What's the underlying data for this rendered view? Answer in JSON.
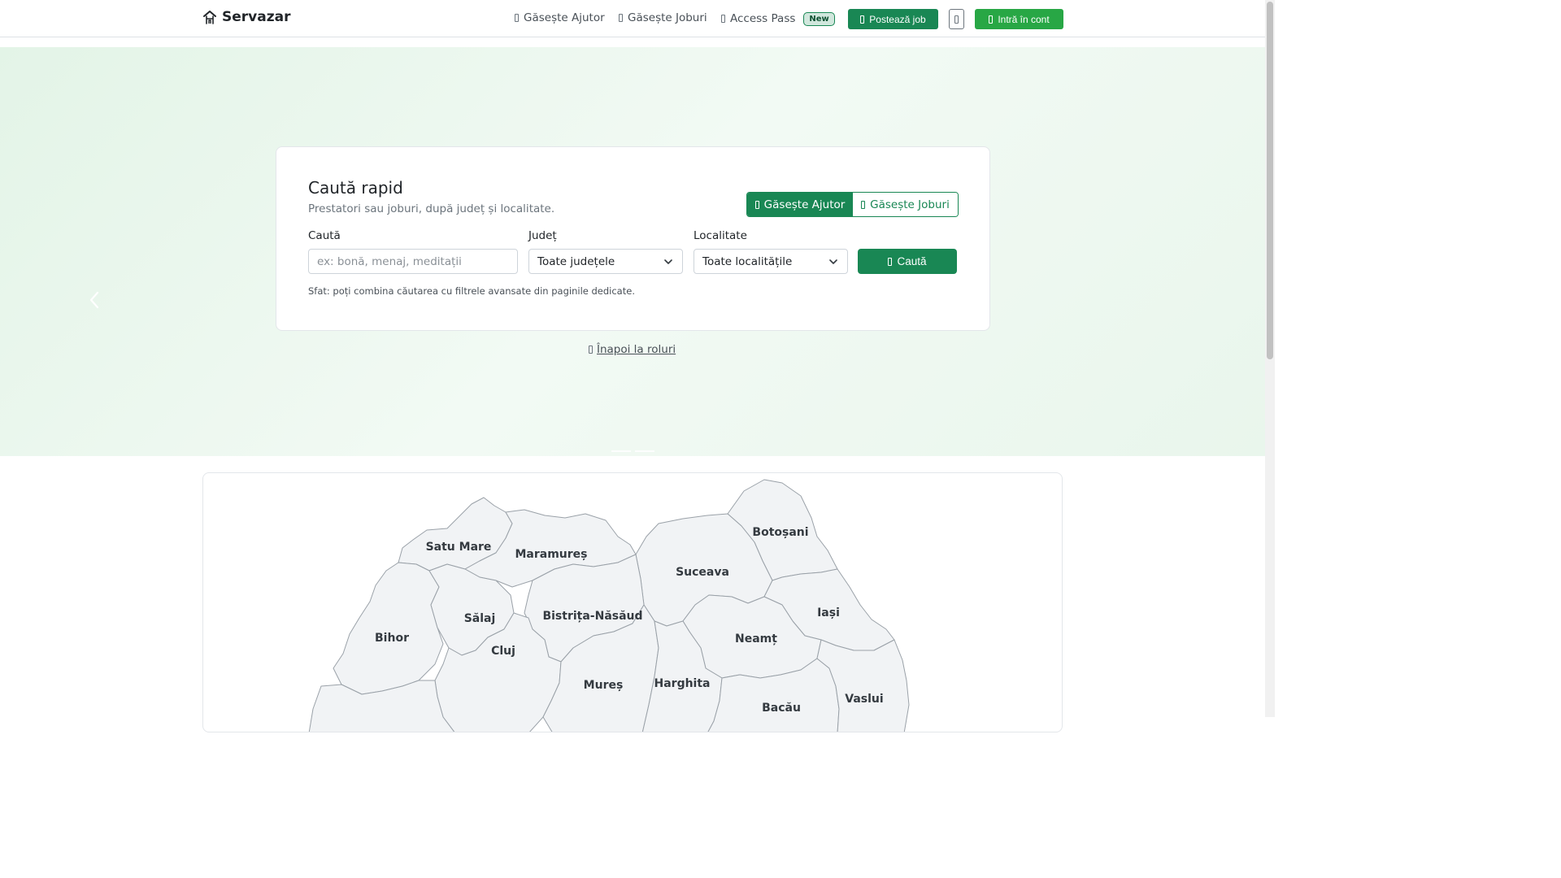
{
  "brand": {
    "name": "Servazar",
    "icon": "home-icon"
  },
  "nav": {
    "find_help": "Găsește Ajutor",
    "find_jobs": "Găsește Joburi",
    "access_pass": "Access Pass",
    "new_badge": "New",
    "post_job": "Postează job",
    "login": "Intră în cont"
  },
  "search": {
    "title": "Caută rapid",
    "subtitle": "Prestatori sau joburi, după județ și localitate.",
    "toggle_help": "Găsește Ajutor",
    "toggle_jobs": "Găsește Joburi",
    "query_label": "Caută",
    "query_placeholder": "ex: bonă, menaj, meditații",
    "county_label": "Județ",
    "county_value": "Toate județele",
    "locality_label": "Localitate",
    "locality_value": "Toate localitățile",
    "submit": "Caută",
    "tip": "Sfat: poți combina căutarea cu filtrele avansate din paginile dedicate."
  },
  "back_link": "Înapoi la roluri",
  "map": {
    "counties": [
      {
        "id": "satu-mare",
        "name": "Satu Mare"
      },
      {
        "id": "maramures",
        "name": "Maramureș"
      },
      {
        "id": "botosani",
        "name": "Botoșani"
      },
      {
        "id": "suceava",
        "name": "Suceava"
      },
      {
        "id": "bihor",
        "name": "Bihor"
      },
      {
        "id": "salaj",
        "name": "Sălaj"
      },
      {
        "id": "bistrita-nasaud",
        "name": "Bistrița-Năsăud"
      },
      {
        "id": "iasi",
        "name": "Iași"
      },
      {
        "id": "neamt",
        "name": "Neamț"
      },
      {
        "id": "cluj",
        "name": "Cluj"
      },
      {
        "id": "mures",
        "name": "Mureș"
      },
      {
        "id": "harghita",
        "name": "Harghita"
      },
      {
        "id": "bacau",
        "name": "Bacău"
      },
      {
        "id": "vaslui",
        "name": "Vaslui"
      }
    ]
  },
  "colors": {
    "primary": "#198754",
    "login": "#28a745",
    "badge_bg": "#d1e7dd"
  }
}
